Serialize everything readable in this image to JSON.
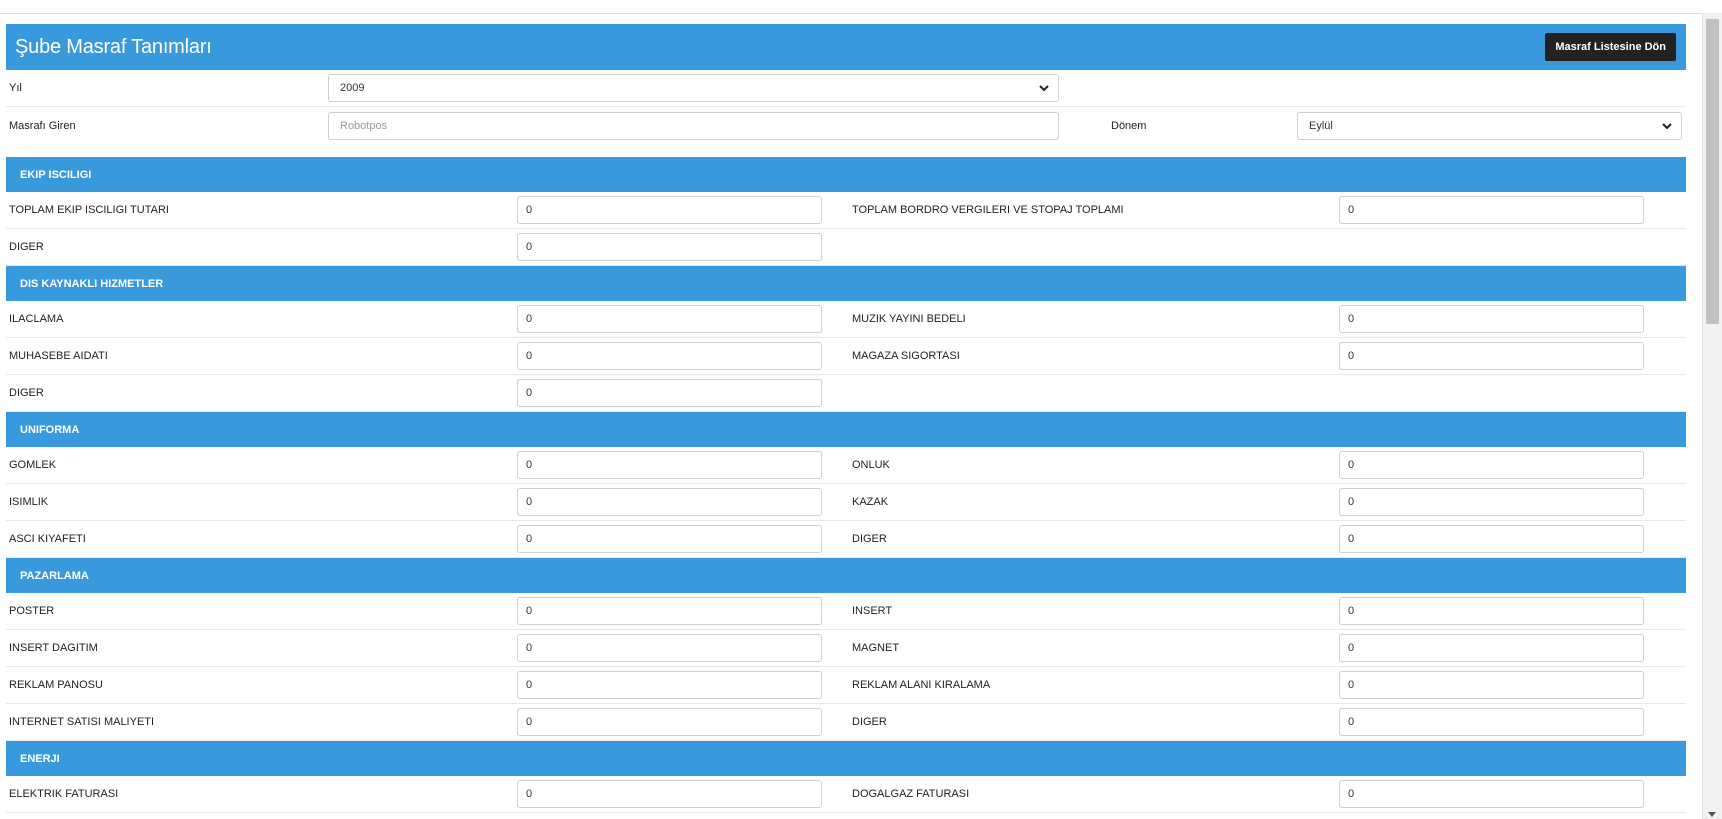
{
  "header": {
    "title": "Şube Masraf Tanımları",
    "back_button": "Masraf Listesine Dön"
  },
  "filters": {
    "year_label": "Yıl",
    "year_value": "2009",
    "entered_by_label": "Masrafı Giren",
    "entered_by_placeholder": "Robotpos",
    "period_label": "Dönem",
    "period_value": "Eylül"
  },
  "sections": [
    {
      "title": "EKIP ISCILIGI",
      "rows": [
        [
          {
            "label": "TOPLAM EKIP ISCILIGI TUTARI",
            "value": "0"
          },
          {
            "label": "TOPLAM BORDRO VERGILERI VE STOPAJ TOPLAMI",
            "value": "0"
          }
        ],
        [
          {
            "label": "DIGER",
            "value": "0"
          }
        ]
      ]
    },
    {
      "title": "DIS KAYNAKLI HIZMETLER",
      "rows": [
        [
          {
            "label": "ILACLAMA",
            "value": "0"
          },
          {
            "label": "MUZIK YAYINI BEDELI",
            "value": "0"
          }
        ],
        [
          {
            "label": "MUHASEBE AIDATI",
            "value": "0"
          },
          {
            "label": "MAGAZA SIGORTASI",
            "value": "0"
          }
        ],
        [
          {
            "label": "DIGER",
            "value": "0"
          }
        ]
      ]
    },
    {
      "title": "UNIFORMA",
      "rows": [
        [
          {
            "label": "GOMLEK",
            "value": "0"
          },
          {
            "label": "ONLUK",
            "value": "0"
          }
        ],
        [
          {
            "label": "ISIMLIK",
            "value": "0"
          },
          {
            "label": "KAZAK",
            "value": "0"
          }
        ],
        [
          {
            "label": "ASCI KIYAFETI",
            "value": "0"
          },
          {
            "label": "DIGER",
            "value": "0"
          }
        ]
      ]
    },
    {
      "title": "PAZARLAMA",
      "rows": [
        [
          {
            "label": "POSTER",
            "value": "0"
          },
          {
            "label": "INSERT",
            "value": "0"
          }
        ],
        [
          {
            "label": "INSERT DAGITIM",
            "value": "0"
          },
          {
            "label": "MAGNET",
            "value": "0"
          }
        ],
        [
          {
            "label": "REKLAM PANOSU",
            "value": "0"
          },
          {
            "label": "REKLAM ALANI KIRALAMA",
            "value": "0"
          }
        ],
        [
          {
            "label": "INTERNET SATISI MALIYETI",
            "value": "0"
          },
          {
            "label": "DIGER",
            "value": "0"
          }
        ]
      ]
    },
    {
      "title": "ENERJI",
      "rows": [
        [
          {
            "label": "ELEKTRIK FATURASI",
            "value": "0"
          },
          {
            "label": "DOGALGAZ FATURASI",
            "value": "0"
          }
        ]
      ]
    }
  ]
}
